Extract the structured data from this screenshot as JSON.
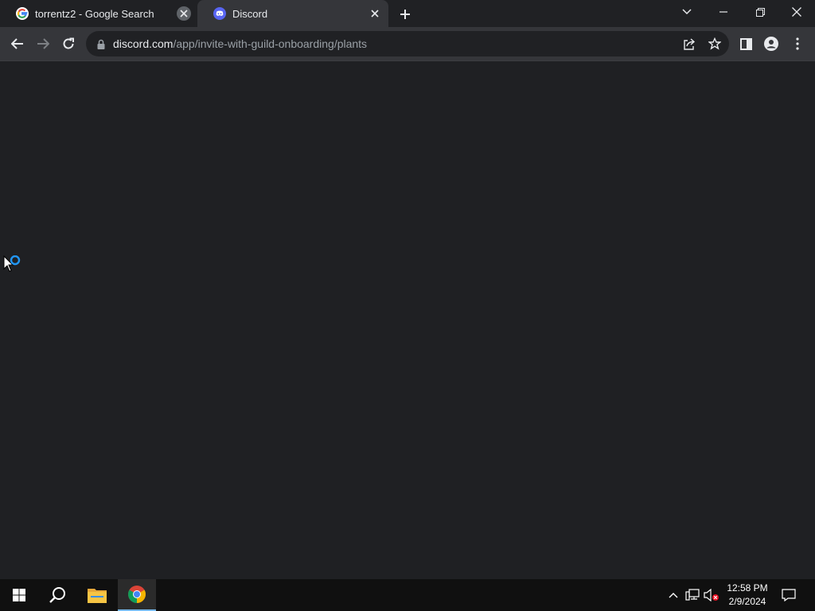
{
  "browser": {
    "tabs": [
      {
        "title": "torrentz2 - Google Search",
        "favicon": "google-icon",
        "active": false
      },
      {
        "title": "Discord",
        "favicon": "discord-icon",
        "active": true
      }
    ],
    "address_bar": {
      "host": "discord.com",
      "path": "/app/invite-with-guild-onboarding/plants"
    }
  },
  "taskbar": {
    "pinned": [
      "windows-start-icon",
      "search-icon",
      "file-explorer-icon",
      "chrome-icon"
    ],
    "clock": {
      "time": "12:58 PM",
      "date": "2/9/2024"
    }
  },
  "colors": {
    "page_background": "#1f2023",
    "tab_strip": "#202124",
    "toolbar": "#35363a",
    "discord_blurple": "#5865f2",
    "loading_ring": "#2196f3"
  }
}
